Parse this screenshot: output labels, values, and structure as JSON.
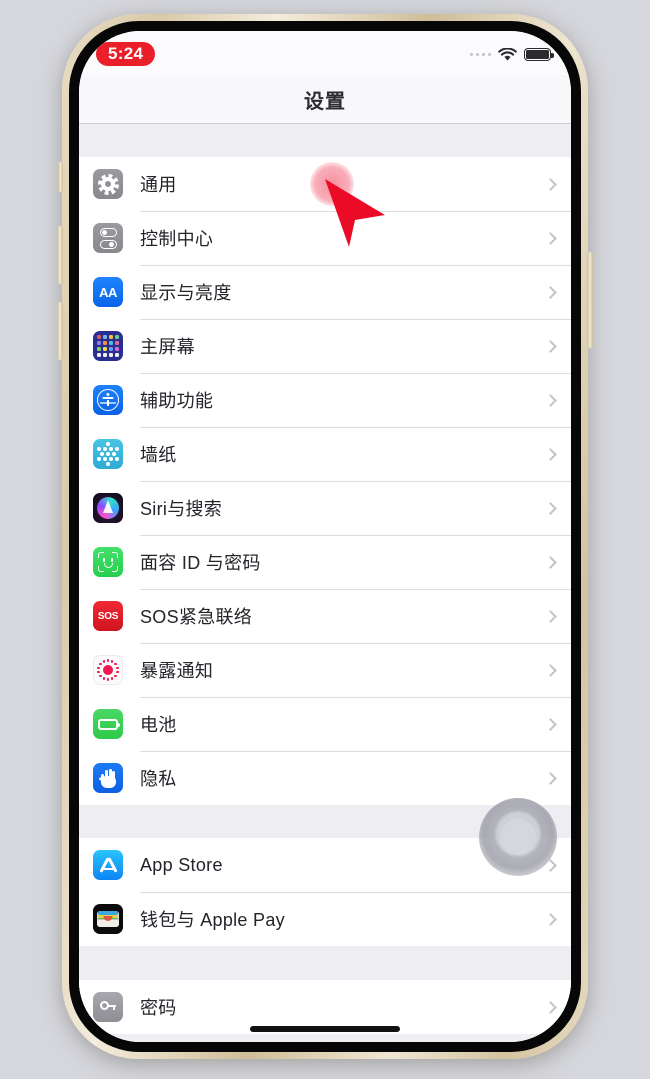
{
  "device": {
    "frame_color": "#d8c9a8",
    "bezel_color": "#070707"
  },
  "status_bar": {
    "recording_time": "5:24",
    "recording_pill_color": "#eb1f2a",
    "signal_icon": "signal-dots-icon",
    "wifi_icon": "wifi-icon",
    "battery_icon": "battery-icon"
  },
  "nav_bar": {
    "title": "设置"
  },
  "groups": [
    {
      "id": "system-group",
      "rows": [
        {
          "label": "通用",
          "icon": "gear-icon",
          "color": "#8e8e93"
        },
        {
          "label": "控制中心",
          "icon": "control-center-icon",
          "color": "#8e8e93"
        },
        {
          "label": "显示与亮度",
          "icon": "display-brightness-icon",
          "color": "#147efb"
        },
        {
          "label": "主屏幕",
          "icon": "home-screen-icon",
          "color": "#2a2f8f"
        },
        {
          "label": "辅助功能",
          "icon": "accessibility-icon",
          "color": "#1472f5"
        },
        {
          "label": "墙纸",
          "icon": "wallpaper-icon",
          "color": "#3ab7dd"
        },
        {
          "label": "Siri与搜索",
          "icon": "siri-icon",
          "color": "#1a1022"
        },
        {
          "label": "面容 ID 与密码",
          "icon": "face-id-icon",
          "color": "#32d74b"
        },
        {
          "label": "SOS紧急联络",
          "icon": "sos-icon",
          "color": "#e0202c"
        },
        {
          "label": "暴露通知",
          "icon": "exposure-notification-icon",
          "color": "#f0184f"
        },
        {
          "label": "电池",
          "icon": "battery-settings-icon",
          "color": "#34c94a"
        },
        {
          "label": "隐私",
          "icon": "privacy-hand-icon",
          "color": "#156ae8"
        }
      ]
    },
    {
      "id": "store-group",
      "rows": [
        {
          "label": "App Store",
          "icon": "app-store-icon",
          "color": "#118ef5"
        },
        {
          "label": "钱包与 Apple Pay",
          "icon": "wallet-icon",
          "color": "#0b0b0d"
        }
      ]
    },
    {
      "id": "passwords-group",
      "rows": [
        {
          "label": "密码",
          "icon": "passwords-key-icon",
          "color": "#8e8e93"
        }
      ]
    }
  ],
  "overlay": {
    "assistive_touch": "assistive-touch-button",
    "cursor": "mouse-cursor-arrow",
    "cursor_color": "#ec0b26",
    "tap_highlight_color": "#f46e82",
    "home_indicator": "home-indicator"
  }
}
